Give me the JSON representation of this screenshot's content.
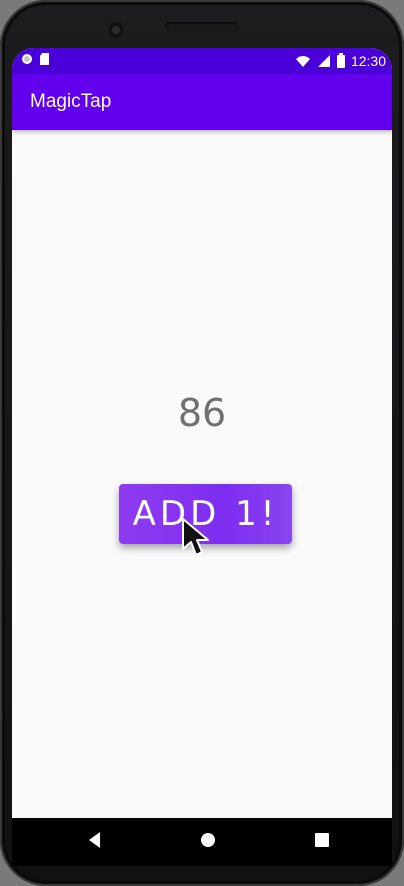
{
  "app": {
    "title": "MagicTap"
  },
  "status_bar": {
    "time": "12:30",
    "icons": [
      "record-icon",
      "sd-card-icon",
      "wifi-icon",
      "signal-icon",
      "battery-icon"
    ]
  },
  "main": {
    "counter_value": "86",
    "add_button_label": "ADD 1!"
  },
  "navigation": {
    "buttons": [
      "back-icon",
      "home-icon",
      "recent-apps-icon"
    ]
  },
  "colors": {
    "app_bar": "#6200ee",
    "status_bar": "#4a00d8",
    "button": "#7d2df0",
    "counter_text": "#707070"
  }
}
